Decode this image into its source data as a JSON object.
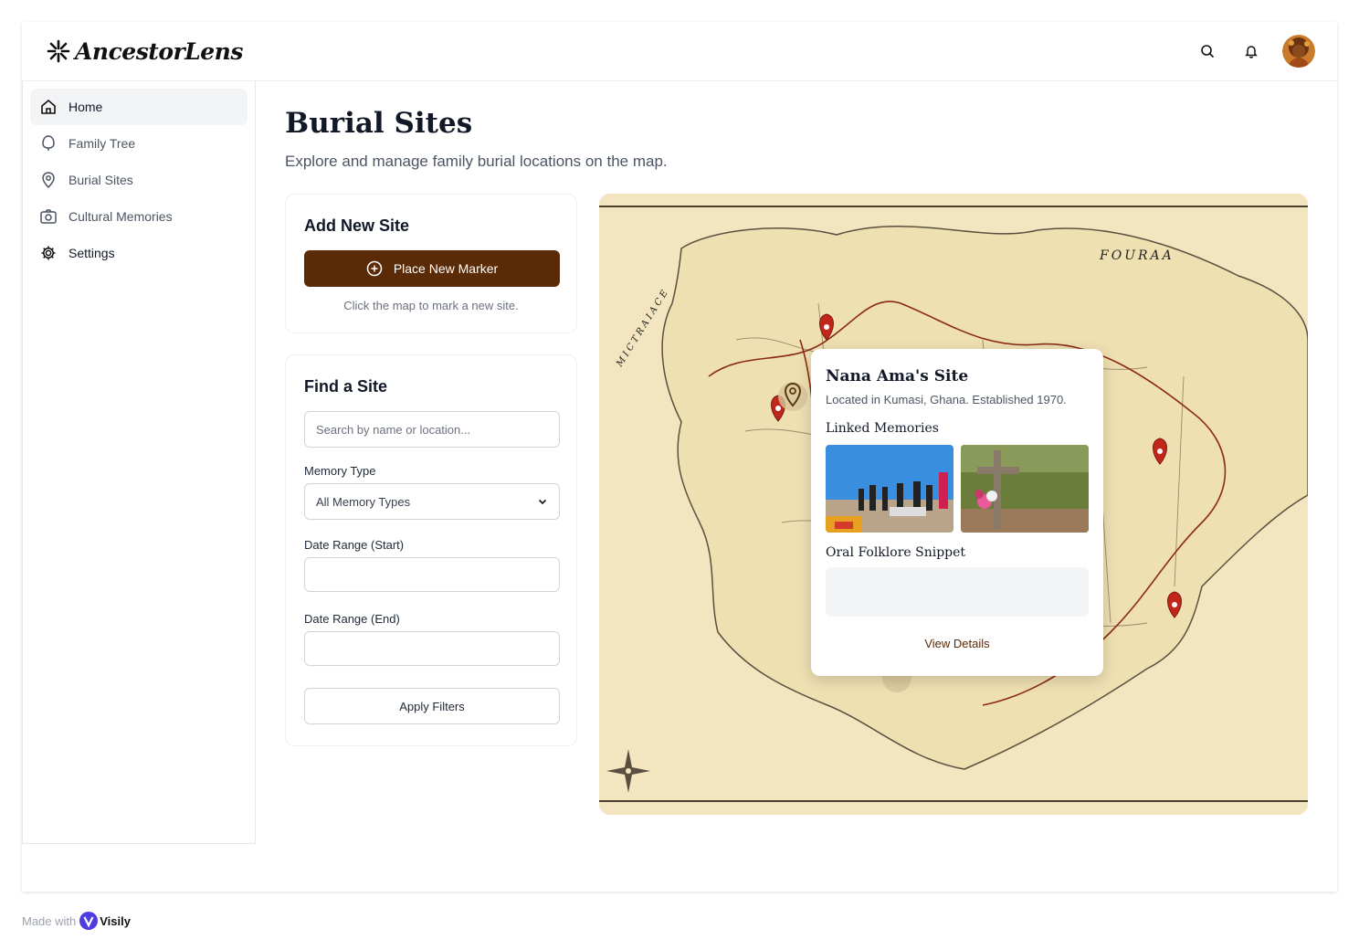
{
  "app": {
    "name": "AncestorLens"
  },
  "sidebar": {
    "items": [
      {
        "label": "Home",
        "icon": "home-icon"
      },
      {
        "label": "Family Tree",
        "icon": "tree-icon"
      },
      {
        "label": "Burial Sites",
        "icon": "map-pin-icon"
      },
      {
        "label": "Cultural Memories",
        "icon": "camera-icon"
      },
      {
        "label": "Settings",
        "icon": "gear-icon"
      }
    ]
  },
  "page": {
    "title": "Burial Sites",
    "subtitle": "Explore and manage family burial locations on the map."
  },
  "add_site": {
    "title": "Add New Site",
    "button_label": "Place New Marker",
    "hint": "Click the map to mark a new site."
  },
  "find_site": {
    "title": "Find a Site",
    "search_placeholder": "Search by name or location...",
    "memory_type_label": "Memory Type",
    "memory_type_value": "All Memory Types",
    "date_start_label": "Date Range (Start)",
    "date_end_label": "Date Range (End)",
    "apply_label": "Apply Filters"
  },
  "map": {
    "labels": [
      "FOURAA",
      "MICTRAIACE"
    ],
    "popup": {
      "title": "Nana Ama's Site",
      "subtitle": "Located in Kumasi, Ghana. Established 1970.",
      "memories_heading": "Linked Memories",
      "folklore_heading": "Oral Folklore Snippet",
      "view_details": "View Details"
    }
  },
  "footer": {
    "made_with": "Made with",
    "brand": "Visily"
  },
  "colors": {
    "primary": "#5b2a06",
    "map_bg": "#f4e6c2",
    "route": "#8b2a12",
    "marker": "#c0261a"
  }
}
